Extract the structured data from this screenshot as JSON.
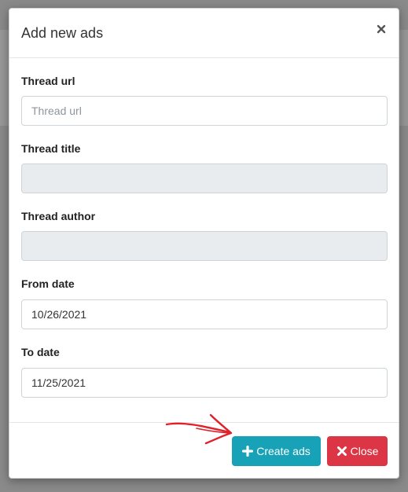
{
  "modal": {
    "title": "Add new ads",
    "close_icon": "close-icon"
  },
  "form": {
    "thread_url": {
      "label": "Thread url",
      "placeholder": "Thread url",
      "value": ""
    },
    "thread_title": {
      "label": "Thread title",
      "value": ""
    },
    "thread_author": {
      "label": "Thread author",
      "value": ""
    },
    "from_date": {
      "label": "From date",
      "value": "10/26/2021"
    },
    "to_date": {
      "label": "To date",
      "value": "11/25/2021"
    }
  },
  "footer": {
    "create_label": "Create ads",
    "create_icon": "plus-icon",
    "close_label": "Close",
    "close_icon": "times-icon"
  },
  "colors": {
    "primary": "#17a2b8",
    "danger": "#dc3545",
    "annotation": "#e0202a"
  }
}
